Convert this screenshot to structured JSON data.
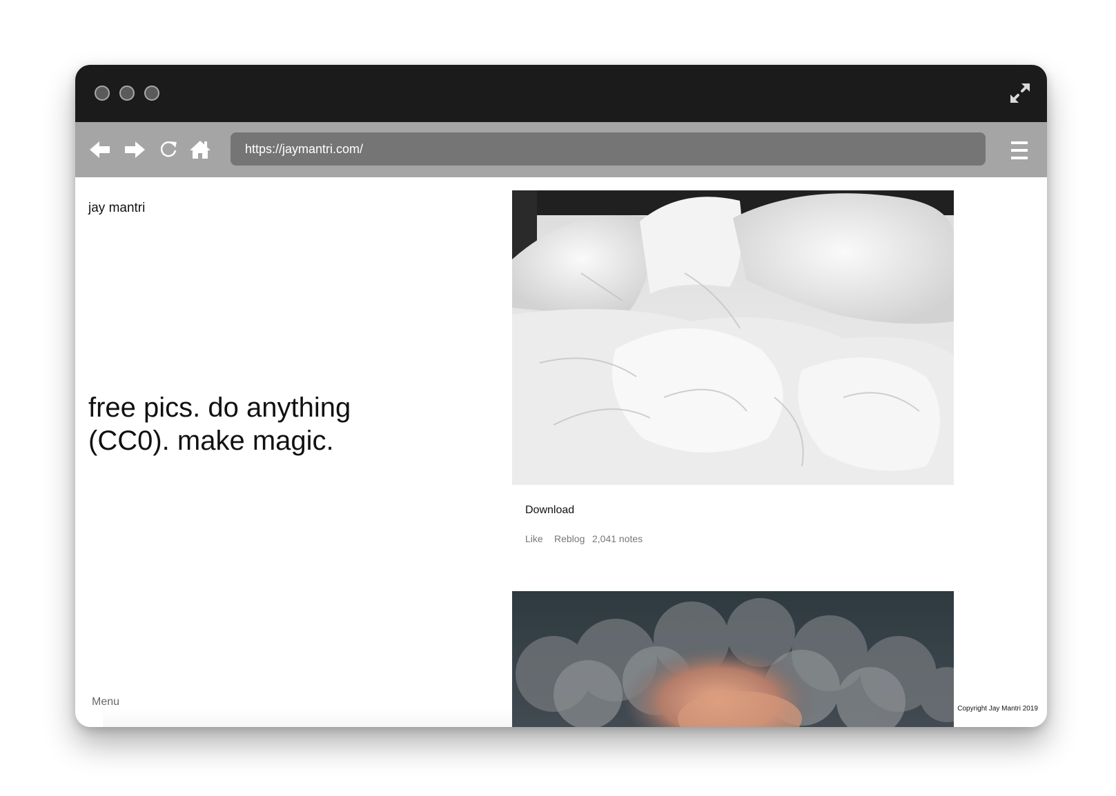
{
  "browser": {
    "url": "https://jaymantri.com/",
    "colors": {
      "titlebar": "#1b1b1b",
      "toolbar": "#a5a5a5",
      "urlbar": "#757575"
    },
    "icons": [
      "back-arrow-icon",
      "forward-arrow-icon",
      "reload-icon",
      "home-icon",
      "hamburger-menu-icon",
      "fullscreen-icon"
    ]
  },
  "site": {
    "title": "jay mantri",
    "tagline": "free pics. do anything (CC0). make magic.",
    "menu_label": "Menu",
    "copyright": "Copyright Jay Mantri 2019"
  },
  "posts": [
    {
      "image": "white-bed-sheets-photo",
      "download_label": "Download",
      "like_label": "Like",
      "reblog_label": "Reblog",
      "notes": "2,041 notes"
    },
    {
      "image": "clouds-photo"
    }
  ]
}
